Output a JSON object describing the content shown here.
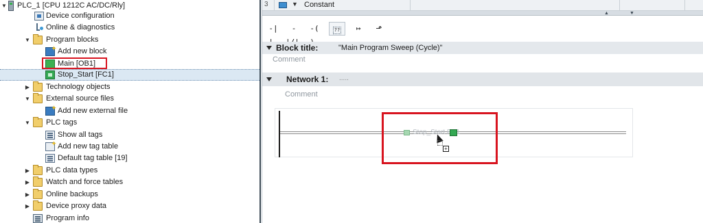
{
  "tree": {
    "root": "PLC_1 [CPU 1212C AC/DC/Rly]",
    "items": [
      {
        "label": "Device configuration",
        "icon": "device-config-icon"
      },
      {
        "label": "Online & diagnostics",
        "icon": "diagnostics-icon"
      },
      {
        "label": "Program blocks",
        "icon": "folder-icon"
      },
      {
        "label": "Add new block",
        "icon": "add-block-icon"
      },
      {
        "label": "Main [OB1]",
        "icon": "ob-block-icon"
      },
      {
        "label": "Stop_Start [FC1]",
        "icon": "fc-block-icon"
      },
      {
        "label": "Technology objects",
        "icon": "folder-icon"
      },
      {
        "label": "External source files",
        "icon": "folder-icon"
      },
      {
        "label": "Add new external file",
        "icon": "add-file-icon"
      },
      {
        "label": "PLC tags",
        "icon": "folder-icon"
      },
      {
        "label": "Show all tags",
        "icon": "tags-icon"
      },
      {
        "label": "Add new tag table",
        "icon": "add-tag-table-icon"
      },
      {
        "label": "Default tag table [19]",
        "icon": "tag-table-icon"
      },
      {
        "label": "PLC data types",
        "icon": "folder-icon"
      },
      {
        "label": "Watch and force tables",
        "icon": "folder-icon"
      },
      {
        "label": "Online backups",
        "icon": "folder-icon"
      },
      {
        "label": "Device proxy data",
        "icon": "folder-icon"
      },
      {
        "label": "Program info",
        "icon": "program-info-icon"
      }
    ]
  },
  "interface": {
    "row_number": "3",
    "section_label": "Constant"
  },
  "toolbar": {
    "no_contact": "-| |-",
    "nc_contact": "-|/|-",
    "coil": "-( )-",
    "empty_box": "??",
    "open_branch": "↦",
    "close_branch": "⬏"
  },
  "block": {
    "title_label": "Block title:",
    "title_value": "\"Main Program Sweep (Cycle)\"",
    "comment": "Comment"
  },
  "network": {
    "label": "Network 1:",
    "title_placeholder": ".....",
    "comment": "Comment",
    "ghost_block": "Stop_Start FC1"
  },
  "colors": {
    "highlight_red": "#d8141f",
    "selection": "#dbe8f3",
    "header_gray": "#e4e8ec"
  }
}
